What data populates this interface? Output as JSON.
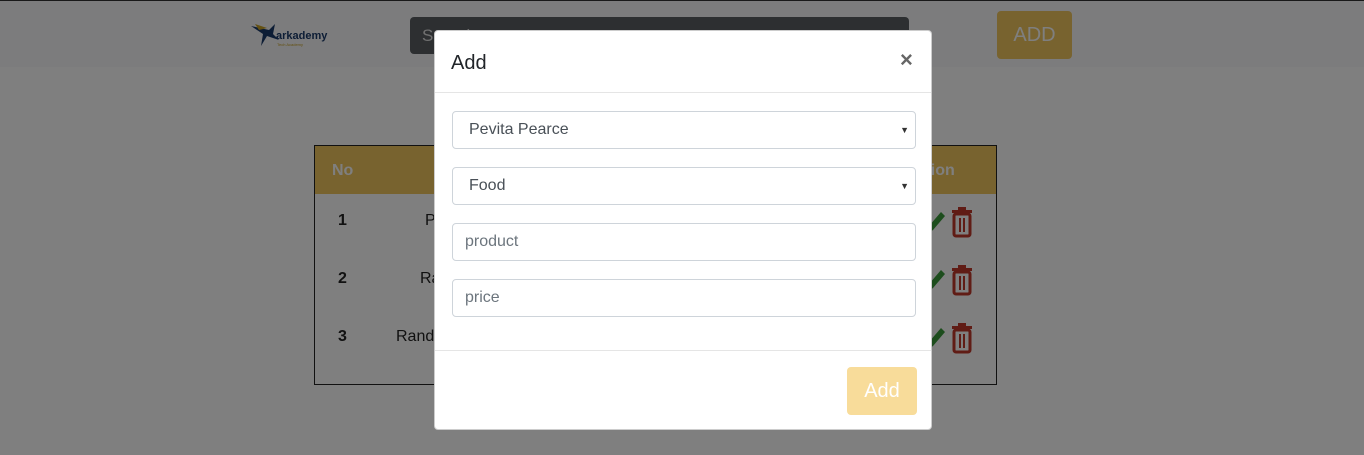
{
  "header": {
    "logo_text": "arkademy",
    "logo_sub": "Tech Academy",
    "search_placeholder": "Search",
    "add_button": "ADD"
  },
  "table": {
    "headers": {
      "no": "No",
      "action": "Action"
    },
    "rows": [
      {
        "no": "1",
        "name": "P"
      },
      {
        "no": "2",
        "name": "Ra"
      },
      {
        "no": "3",
        "name": "Randi"
      }
    ]
  },
  "modal": {
    "title": "Add",
    "close_glyph": "×",
    "cashier_select": "Pevita Pearce",
    "category_select": "Food",
    "product_placeholder": "product",
    "price_placeholder": "price",
    "submit_button": "Add"
  },
  "colors": {
    "accent": "#f0c65f",
    "edit": "#3a9a3a",
    "delete": "#c0392b"
  },
  "icons": {
    "edit": "pencil-icon",
    "delete": "trash-icon",
    "close": "close-icon",
    "caret": "caret-down-icon"
  }
}
